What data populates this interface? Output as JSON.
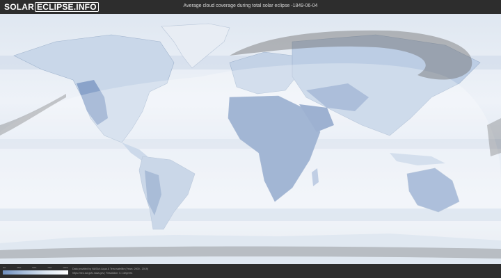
{
  "header": {
    "logo_part1": "SOLAR",
    "logo_part2": "ECLIPSE.INFO",
    "title": "Average cloud coverage during total solar eclipse -1849-06-04"
  },
  "legend": {
    "ticks": [
      "0%",
      "25%",
      "50%",
      "75%",
      "100%"
    ],
    "colors": [
      "#6f8fbf",
      "#a9bfdc",
      "#dde7f2",
      "#ffffff"
    ]
  },
  "credits": {
    "line1": "Data provided by NASA's Aqua & Terra satellite (Years: 2000 - 2019)",
    "line2": "https://neo.sci.gsfc.nasa.gov  |  Resolution: 0.1 degrees"
  },
  "colors": {
    "ocean_cloud": "#e9eef6",
    "clear_land": "#7f9ac4",
    "eclipse_shadow": "#8a8a8a",
    "background": "#2b2b2b"
  }
}
